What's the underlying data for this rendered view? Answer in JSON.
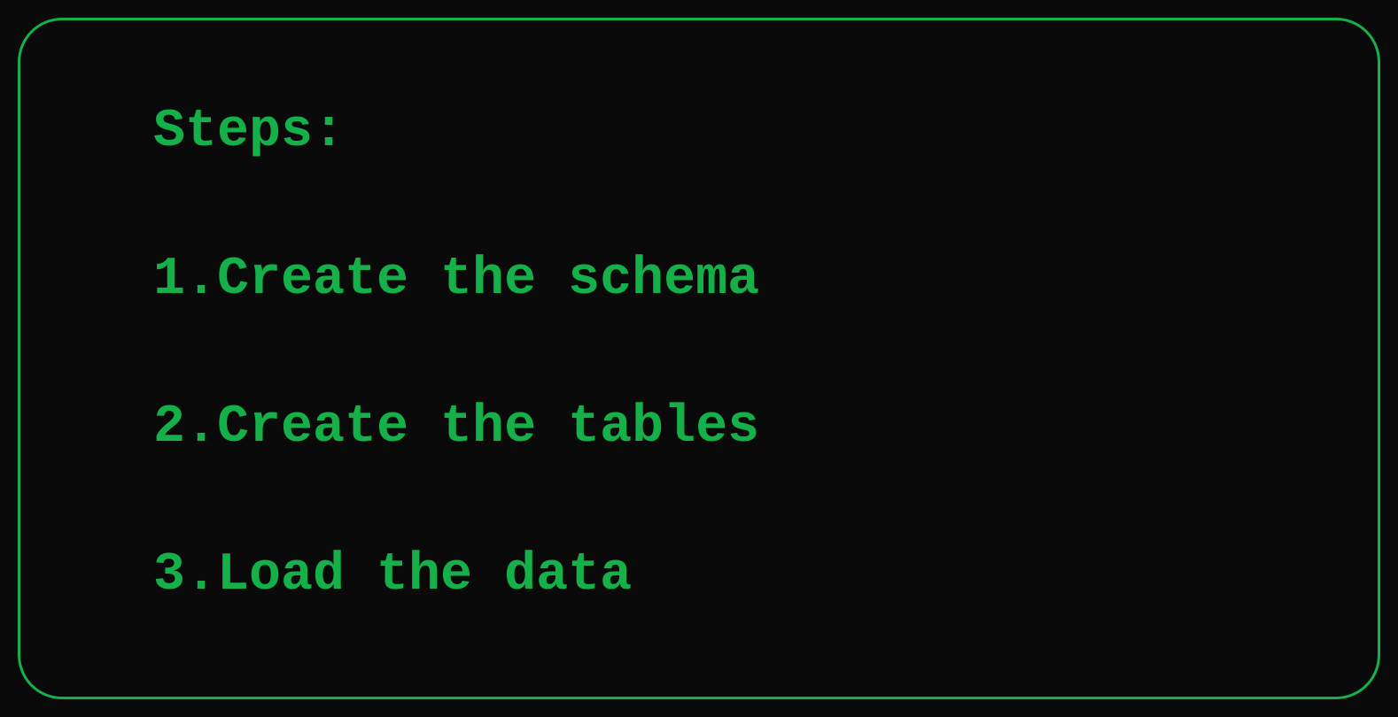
{
  "heading": "Steps:",
  "steps": [
    "1.Create the schema",
    "2.Create the tables",
    "3.Load the data"
  ]
}
